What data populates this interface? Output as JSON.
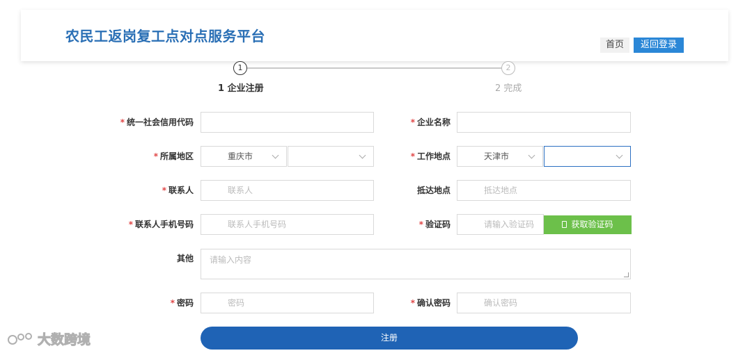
{
  "header": {
    "title": "农民工返岗复工点对点服务平台",
    "nav_home": "首页",
    "nav_back_login": "返回登录"
  },
  "steps": {
    "step1_number": "1",
    "step1_label": "1 企业注册",
    "step2_number": "2",
    "step2_label": "2 完成"
  },
  "form": {
    "required_mark": "*",
    "credit_code_label": "统一社会信用代码",
    "company_name_label": "企业名称",
    "region_label": "所属地区",
    "region_city": "重庆市",
    "region_district": "",
    "work_location_label": "工作地点",
    "work_city": "天津市",
    "work_district": "",
    "contact_label": "联系人",
    "contact_placeholder": "联系人",
    "arrival_label": "抵达地点",
    "arrival_placeholder": "抵达地点",
    "contact_phone_label": "联系人手机号码",
    "contact_phone_placeholder": "联系人手机号码",
    "verify_code_label": "验证码",
    "verify_code_placeholder": "请输入验证码",
    "get_code_button": "获取验证码",
    "other_label": "其他",
    "other_placeholder": "请输入内容",
    "password_label": "密码",
    "password_placeholder": "密码",
    "confirm_password_label": "确认密码",
    "confirm_password_placeholder": "确认密码",
    "register_button": "注册"
  },
  "watermark": {
    "text": "大数跨境"
  },
  "colors": {
    "title_blue": "#2a6fb5",
    "nav_blue": "#2b87d7",
    "green_button": "#6cc04a",
    "register_blue": "#1f63b5",
    "required_red": "#e04646"
  }
}
